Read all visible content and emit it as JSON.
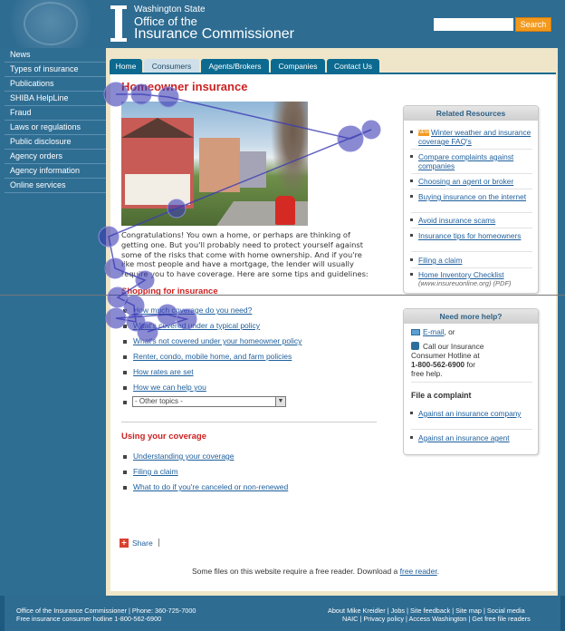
{
  "header": {
    "state": "Washington State",
    "office_line1": "Office of the",
    "office_line2": "Insurance Commissioner",
    "search_placeholder": "",
    "search_button": "Search"
  },
  "leftnav": {
    "items": [
      {
        "label": "News"
      },
      {
        "label": "Types of insurance"
      },
      {
        "label": "Publications"
      },
      {
        "label": "SHIBA HelpLine"
      },
      {
        "label": "Fraud"
      },
      {
        "label": "Laws or regulations"
      },
      {
        "label": "Public disclosure"
      },
      {
        "label": "Agency orders"
      },
      {
        "label": "Agency information"
      },
      {
        "label": "Online services"
      }
    ]
  },
  "tabs": [
    {
      "label": "Home",
      "active": false
    },
    {
      "label": "Consumers",
      "active": true
    },
    {
      "label": "Agents/Brokers",
      "active": false
    },
    {
      "label": "Companies",
      "active": false
    },
    {
      "label": "Contact Us",
      "active": false
    }
  ],
  "main": {
    "title": "Homeowner insurance",
    "intro": "Congratulations! You own a home, or perhaps are thinking of getting one. But you'll probably need to protect yourself against some of the risks that come with home ownership. And if you're like most people and have a mortgage, the lender will usually require you to have coverage. Here are some tips and guidelines:",
    "shopping_title": "Shopping for insurance",
    "shopping_links": [
      {
        "label": "How much coverage do you need?"
      },
      {
        "label": "What's covered under a typical policy"
      },
      {
        "label": "What's not covered under your homeowner policy"
      },
      {
        "label": "Renter, condo, mobile home, and farm policies"
      },
      {
        "label": "How rates are set"
      },
      {
        "label": "How we can help you"
      }
    ],
    "other_topics": "- Other topics -",
    "using_title": "Using your coverage",
    "using_links": [
      {
        "label": "Understanding your coverage"
      },
      {
        "label": "Filing a claim"
      },
      {
        "label": "What to do if you're canceled or non-renewed"
      }
    ],
    "share_label": "Share",
    "share_pipe": "|",
    "reader_note_prefix": "Some files on this website require a free reader. Download a ",
    "reader_note_link": "free reader",
    "reader_note_suffix": "."
  },
  "related": {
    "heading": "Related Resources",
    "new_badge": "NEW",
    "items": [
      {
        "label": "Winter weather and insurance coverage FAQ's"
      },
      {
        "label": "Compare complaints against companies"
      },
      {
        "label": "Choosing an agent or broker"
      },
      {
        "label": "Buying insurance on the internet"
      },
      {
        "label": "Avoid insurance scams"
      },
      {
        "label": "Insurance tips for homeowners"
      },
      {
        "label": "Filing a claim"
      },
      {
        "label": "Home Inventory Checklist"
      }
    ],
    "inventory_sub": "(www.insureuonline.org) (PDF)"
  },
  "help": {
    "heading": "Need more help?",
    "email_link": "E-mail",
    "email_suffix": ", or",
    "call_line1": "Call our Insurance",
    "call_line2": "Consumer Hotline at",
    "hotline_number": "1-800-562-6900",
    "hotline_suffix": " for",
    "call_line4": "free help.",
    "complaint_title": "File a complaint",
    "complaint_links": [
      {
        "label": "Against an insurance company"
      },
      {
        "label": "Against an insurance agent"
      }
    ]
  },
  "footer": {
    "left_line1": "Office of the Insurance Commissioner | Phone: 360-725-7000",
    "left_line2": "Free insurance consumer hotline 1-800-562-6900",
    "right_line1": "About Mike Kreidler | Jobs | Site feedback | Site map | Social media",
    "right_line2": "NAIC | Privacy policy | Access Washington | Get free file readers"
  },
  "colors": {
    "header_blue": "#2e6c92",
    "tab_blue": "#0c6a90",
    "title_red": "#cc2222",
    "search_orange": "#f39a1e",
    "link_blue": "#1e5f9c",
    "gaze_fill": "#3c3cb4"
  }
}
